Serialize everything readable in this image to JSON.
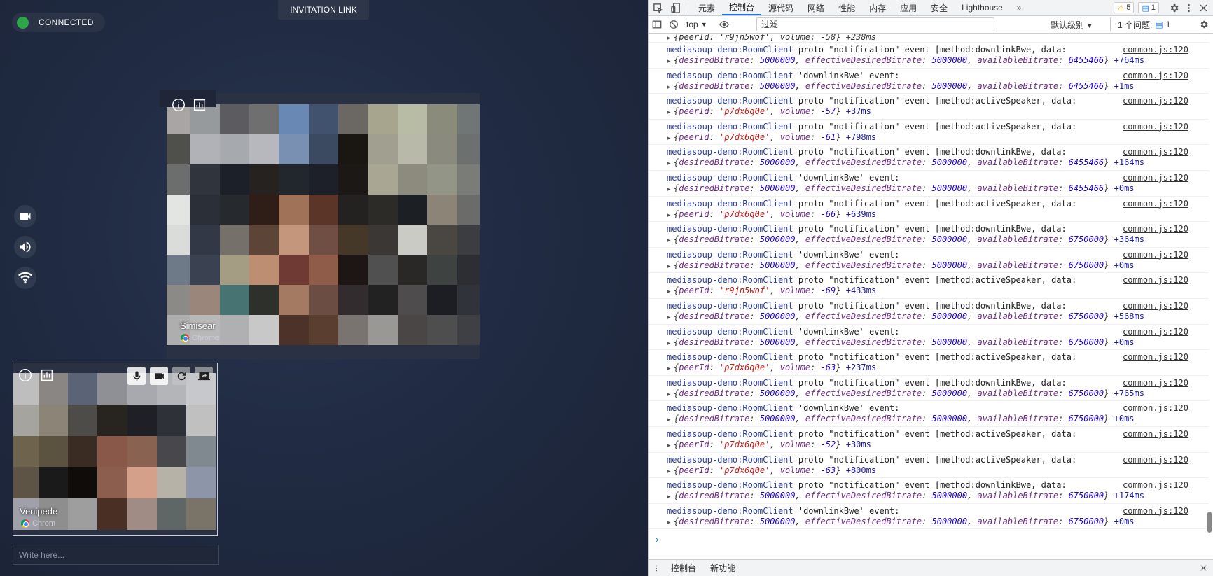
{
  "app": {
    "status_label": "CONNECTED",
    "invitation_label": "INVITATION LINK",
    "chat_placeholder": "Write here...",
    "remote_peer": {
      "name": "Simisear",
      "device": "Chrome"
    },
    "local_peer": {
      "name": "Venipede",
      "device": "Chrom"
    },
    "colors": {
      "connected": "#2ea54a",
      "background": "#1f2940"
    }
  },
  "devtools": {
    "tabs": [
      "元素",
      "控制台",
      "源代码",
      "网络",
      "性能",
      "内存",
      "应用",
      "安全",
      "Lighthouse"
    ],
    "active_tab": "控制台",
    "more_tabs": "»",
    "warnings_count": "5",
    "messages_count": "1",
    "context": "top",
    "filter_placeholder": "过滤",
    "levels_label": "默认级别",
    "issues_label": "1 个问题:",
    "issues_count": "1",
    "first_line": "{peerId: 'r9jn5wof', volume: -58} +238ms",
    "prompt": "›",
    "drawer_tabs": [
      "控制台",
      "新功能"
    ],
    "messages": [
      {
        "src": "mediasoup-demo:RoomClient",
        "text": " proto \"notification\" event [method:downlinkBwe, data:",
        "loc": "common.js:120",
        "obj": [
          [
            "desiredBitrate",
            "5000000",
            "n"
          ],
          [
            "effectiveDesiredBitrate",
            "5000000",
            "n"
          ],
          [
            "availableBitrate",
            "6455466",
            "n"
          ]
        ],
        "delta": "+764ms"
      },
      {
        "src": "mediasoup-demo:RoomClient",
        "text": " 'downlinkBwe' event:",
        "loc": "common.js:120",
        "obj": [
          [
            "desiredBitrate",
            "5000000",
            "n"
          ],
          [
            "effectiveDesiredBitrate",
            "5000000",
            "n"
          ],
          [
            "availableBitrate",
            "6455466",
            "n"
          ]
        ],
        "delta": "+1ms"
      },
      {
        "src": "mediasoup-demo:RoomClient",
        "text": " proto \"notification\" event [method:activeSpeaker, data:",
        "loc": "common.js:120",
        "obj": [
          [
            "peerId",
            "'p7dx6q0e'",
            "s"
          ],
          [
            "volume",
            "-57",
            "n"
          ]
        ],
        "delta": "+37ms"
      },
      {
        "src": "mediasoup-demo:RoomClient",
        "text": " proto \"notification\" event [method:activeSpeaker, data:",
        "loc": "common.js:120",
        "obj": [
          [
            "peerId",
            "'p7dx6q0e'",
            "s"
          ],
          [
            "volume",
            "-61",
            "n"
          ]
        ],
        "delta": "+798ms"
      },
      {
        "src": "mediasoup-demo:RoomClient",
        "text": " proto \"notification\" event [method:downlinkBwe, data:",
        "loc": "common.js:120",
        "obj": [
          [
            "desiredBitrate",
            "5000000",
            "n"
          ],
          [
            "effectiveDesiredBitrate",
            "5000000",
            "n"
          ],
          [
            "availableBitrate",
            "6455466",
            "n"
          ]
        ],
        "delta": "+164ms"
      },
      {
        "src": "mediasoup-demo:RoomClient",
        "text": " 'downlinkBwe' event:",
        "loc": "common.js:120",
        "obj": [
          [
            "desiredBitrate",
            "5000000",
            "n"
          ],
          [
            "effectiveDesiredBitrate",
            "5000000",
            "n"
          ],
          [
            "availableBitrate",
            "6455466",
            "n"
          ]
        ],
        "delta": "+0ms"
      },
      {
        "src": "mediasoup-demo:RoomClient",
        "text": " proto \"notification\" event [method:activeSpeaker, data:",
        "loc": "common.js:120",
        "obj": [
          [
            "peerId",
            "'p7dx6q0e'",
            "s"
          ],
          [
            "volume",
            "-66",
            "n"
          ]
        ],
        "delta": "+639ms"
      },
      {
        "src": "mediasoup-demo:RoomClient",
        "text": " proto \"notification\" event [method:downlinkBwe, data:",
        "loc": "common.js:120",
        "obj": [
          [
            "desiredBitrate",
            "5000000",
            "n"
          ],
          [
            "effectiveDesiredBitrate",
            "5000000",
            "n"
          ],
          [
            "availableBitrate",
            "6750000",
            "n"
          ]
        ],
        "delta": "+364ms"
      },
      {
        "src": "mediasoup-demo:RoomClient",
        "text": " 'downlinkBwe' event:",
        "loc": "common.js:120",
        "obj": [
          [
            "desiredBitrate",
            "5000000",
            "n"
          ],
          [
            "effectiveDesiredBitrate",
            "5000000",
            "n"
          ],
          [
            "availableBitrate",
            "6750000",
            "n"
          ]
        ],
        "delta": "+0ms"
      },
      {
        "src": "mediasoup-demo:RoomClient",
        "text": " proto \"notification\" event [method:activeSpeaker, data:",
        "loc": "common.js:120",
        "obj": [
          [
            "peerId",
            "'r9jn5wof'",
            "s"
          ],
          [
            "volume",
            "-69",
            "n"
          ]
        ],
        "delta": "+433ms"
      },
      {
        "src": "mediasoup-demo:RoomClient",
        "text": " proto \"notification\" event [method:downlinkBwe, data:",
        "loc": "common.js:120",
        "obj": [
          [
            "desiredBitrate",
            "5000000",
            "n"
          ],
          [
            "effectiveDesiredBitrate",
            "5000000",
            "n"
          ],
          [
            "availableBitrate",
            "6750000",
            "n"
          ]
        ],
        "delta": "+568ms"
      },
      {
        "src": "mediasoup-demo:RoomClient",
        "text": " 'downlinkBwe' event:",
        "loc": "common.js:120",
        "obj": [
          [
            "desiredBitrate",
            "5000000",
            "n"
          ],
          [
            "effectiveDesiredBitrate",
            "5000000",
            "n"
          ],
          [
            "availableBitrate",
            "6750000",
            "n"
          ]
        ],
        "delta": "+0ms"
      },
      {
        "src": "mediasoup-demo:RoomClient",
        "text": " proto \"notification\" event [method:activeSpeaker, data:",
        "loc": "common.js:120",
        "obj": [
          [
            "peerId",
            "'p7dx6q0e'",
            "s"
          ],
          [
            "volume",
            "-63",
            "n"
          ]
        ],
        "delta": "+237ms"
      },
      {
        "src": "mediasoup-demo:RoomClient",
        "text": " proto \"notification\" event [method:downlinkBwe, data:",
        "loc": "common.js:120",
        "obj": [
          [
            "desiredBitrate",
            "5000000",
            "n"
          ],
          [
            "effectiveDesiredBitrate",
            "5000000",
            "n"
          ],
          [
            "availableBitrate",
            "6750000",
            "n"
          ]
        ],
        "delta": "+765ms"
      },
      {
        "src": "mediasoup-demo:RoomClient",
        "text": " 'downlinkBwe' event:",
        "loc": "common.js:120",
        "obj": [
          [
            "desiredBitrate",
            "5000000",
            "n"
          ],
          [
            "effectiveDesiredBitrate",
            "5000000",
            "n"
          ],
          [
            "availableBitrate",
            "6750000",
            "n"
          ]
        ],
        "delta": "+0ms"
      },
      {
        "src": "mediasoup-demo:RoomClient",
        "text": " proto \"notification\" event [method:activeSpeaker, data:",
        "loc": "common.js:120",
        "obj": [
          [
            "peerId",
            "'p7dx6q0e'",
            "s"
          ],
          [
            "volume",
            "-52",
            "n"
          ]
        ],
        "delta": "+30ms"
      },
      {
        "src": "mediasoup-demo:RoomClient",
        "text": " proto \"notification\" event [method:activeSpeaker, data:",
        "loc": "common.js:120",
        "obj": [
          [
            "peerId",
            "'p7dx6q0e'",
            "s"
          ],
          [
            "volume",
            "-63",
            "n"
          ]
        ],
        "delta": "+800ms"
      },
      {
        "src": "mediasoup-demo:RoomClient",
        "text": " proto \"notification\" event [method:downlinkBwe, data:",
        "loc": "common.js:120",
        "obj": [
          [
            "desiredBitrate",
            "5000000",
            "n"
          ],
          [
            "effectiveDesiredBitrate",
            "5000000",
            "n"
          ],
          [
            "availableBitrate",
            "6750000",
            "n"
          ]
        ],
        "delta": "+174ms"
      },
      {
        "src": "mediasoup-demo:RoomClient",
        "text": " 'downlinkBwe' event:",
        "loc": "common.js:120",
        "obj": [
          [
            "desiredBitrate",
            "5000000",
            "n"
          ],
          [
            "effectiveDesiredBitrate",
            "5000000",
            "n"
          ],
          [
            "availableBitrate",
            "6750000",
            "n"
          ]
        ],
        "delta": "+0ms"
      }
    ]
  }
}
